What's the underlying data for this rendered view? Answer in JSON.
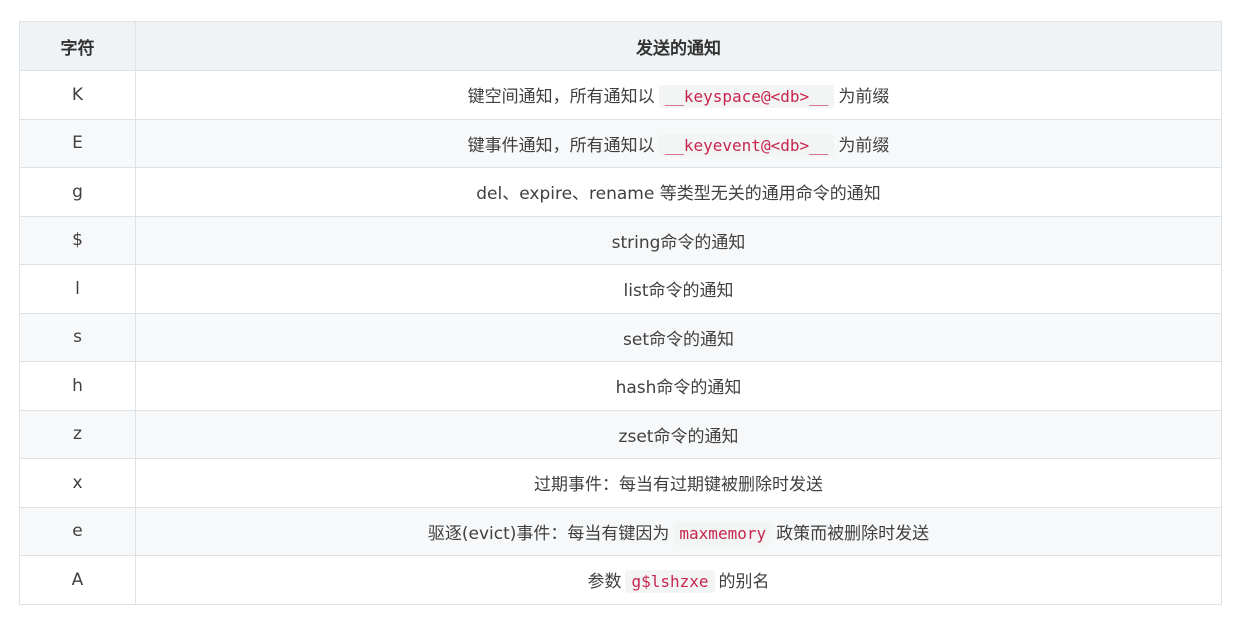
{
  "table": {
    "headers": {
      "char": "字符",
      "notification": "发送的通知"
    },
    "rows": [
      {
        "char": "K",
        "pre": "键空间通知，所有通知以",
        "code": "__keyspace@<db>__",
        "post": "为前缀"
      },
      {
        "char": "E",
        "pre": "键事件通知，所有通知以",
        "code": "__keyevent@<db>__",
        "post": "为前缀"
      },
      {
        "char": "g",
        "pre": "del、expire、rename 等类型无关的通用命令的通知",
        "code": "",
        "post": ""
      },
      {
        "char": "$",
        "pre": "string命令的通知",
        "code": "",
        "post": ""
      },
      {
        "char": "l",
        "pre": "list命令的通知",
        "code": "",
        "post": ""
      },
      {
        "char": "s",
        "pre": "set命令的通知",
        "code": "",
        "post": ""
      },
      {
        "char": "h",
        "pre": "hash命令的通知",
        "code": "",
        "post": ""
      },
      {
        "char": "z",
        "pre": "zset命令的通知",
        "code": "",
        "post": ""
      },
      {
        "char": "x",
        "pre": "过期事件：每当有过期键被删除时发送",
        "code": "",
        "post": ""
      },
      {
        "char": "e",
        "pre": "驱逐(evict)事件：每当有键因为",
        "code": "maxmemory",
        "post": "政策而被删除时发送"
      },
      {
        "char": "A",
        "pre": "参数",
        "code": "g$lshzxe",
        "post": "的别名"
      }
    ]
  }
}
